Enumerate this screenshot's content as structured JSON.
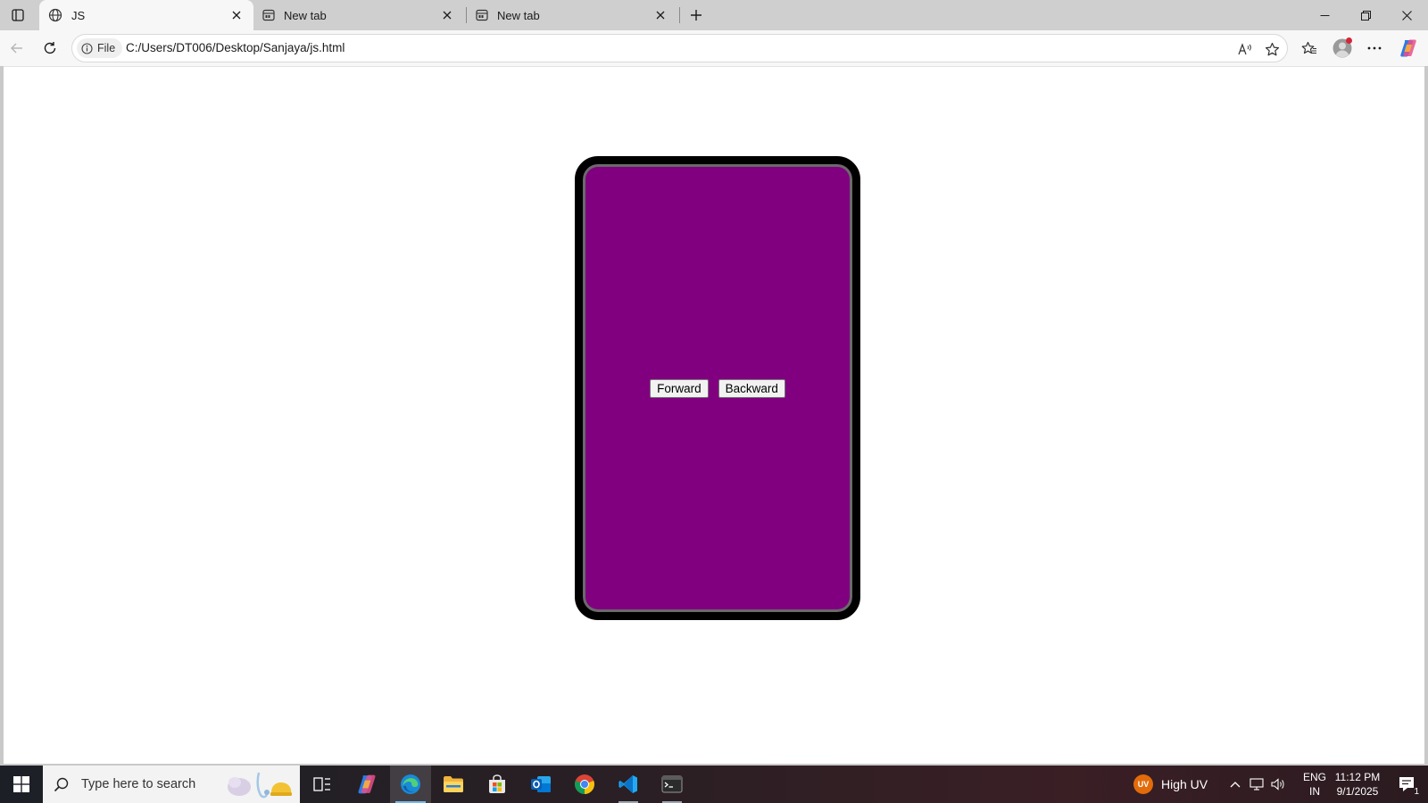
{
  "browser": {
    "tabs": [
      {
        "title": "JS",
        "icon": "globe-icon",
        "active": true
      },
      {
        "title": "New tab",
        "icon": "newtab-page-icon",
        "active": false
      },
      {
        "title": "New tab",
        "icon": "newtab-page-icon",
        "active": false
      }
    ],
    "address": {
      "site_chip": "File",
      "url": "C:/Users/DT006/Desktop/Sanjaya/js.html"
    }
  },
  "page": {
    "device_color": "#800080",
    "buttons": {
      "forward": "Forward",
      "backward": "Backward"
    }
  },
  "taskbar": {
    "search_placeholder": "Type here to search",
    "apps": [
      "task-view",
      "copilot",
      "edge",
      "file-explorer",
      "microsoft-store",
      "outlook",
      "chrome",
      "vscode",
      "terminal"
    ],
    "weather": {
      "badge": "UV",
      "text": "High UV"
    },
    "language": {
      "line1": "ENG",
      "line2": "IN"
    },
    "clock": {
      "time": "11:12 PM",
      "date": "9/1/2025"
    },
    "notifications": "1"
  },
  "colors": {
    "accent": "#0067c0",
    "uv_badge": "#e36b0a",
    "profile_alert": "#d3263a"
  }
}
